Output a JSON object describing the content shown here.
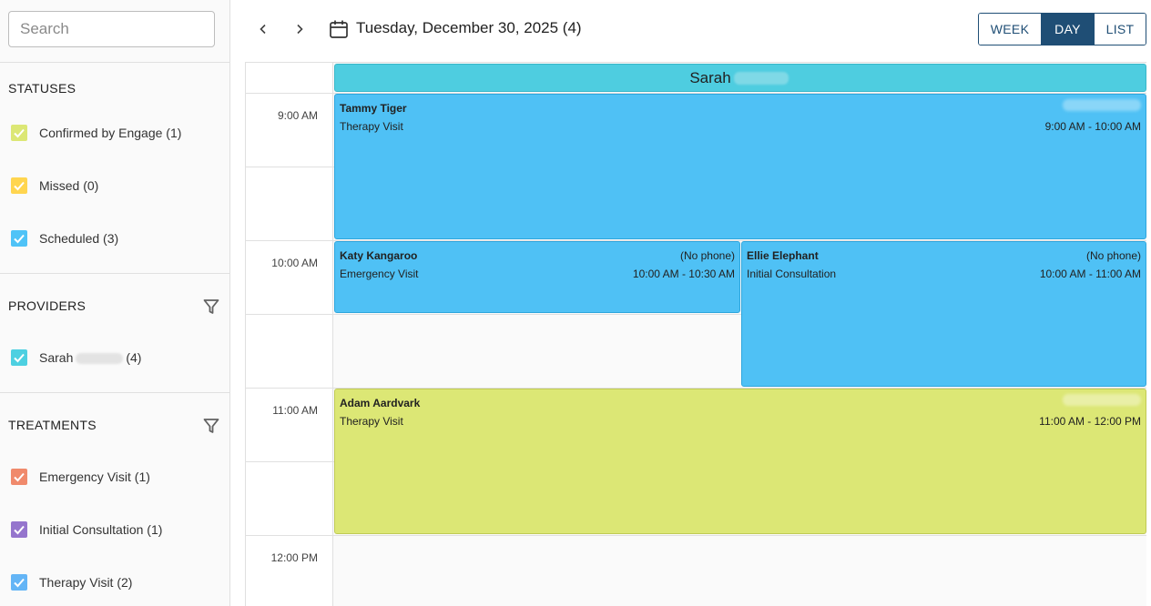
{
  "search": {
    "placeholder": "Search"
  },
  "statuses": {
    "title": "STATUSES",
    "items": [
      {
        "label": "Confirmed by Engage (1)",
        "color": "#dce775"
      },
      {
        "label": "Missed (0)",
        "color": "#ffd54f"
      },
      {
        "label": "Scheduled (3)",
        "color": "#4fc3f7"
      }
    ]
  },
  "providers": {
    "title": "PROVIDERS",
    "items": [
      {
        "first_name": "Sarah",
        "count": "(4)",
        "color": "#4dd0e1"
      }
    ]
  },
  "treatments": {
    "title": "TREATMENTS",
    "items": [
      {
        "label": "Emergency Visit (1)",
        "color": "#f08a6c"
      },
      {
        "label": "Initial Consultation (1)",
        "color": "#9575cd"
      },
      {
        "label": "Therapy Visit (2)",
        "color": "#64b5f6"
      }
    ]
  },
  "header": {
    "date_title": "Tuesday, December 30, 2025 (4)",
    "views": [
      "WEEK",
      "DAY",
      "LIST"
    ],
    "active_view": "DAY"
  },
  "calendar": {
    "resource": "Sarah",
    "times": [
      "9:00 AM",
      "10:00 AM",
      "11:00 AM",
      "12:00 PM"
    ],
    "events": [
      {
        "name": "Tammy Tiger",
        "type": "Therapy Visit",
        "time": "9:00 AM - 10:00 AM",
        "phone": ""
      },
      {
        "name": "Katy Kangaroo",
        "type": "Emergency Visit",
        "time": "10:00 AM - 10:30 AM",
        "phone": "(No phone)"
      },
      {
        "name": "Ellie Elephant",
        "type": "Initial Consultation",
        "time": "10:00 AM - 11:00 AM",
        "phone": "(No phone)"
      },
      {
        "name": "Adam Aardvark",
        "type": "Therapy Visit",
        "time": "11:00 AM - 12:00 PM",
        "phone": ""
      }
    ]
  },
  "colors": {
    "accent": "#1f4e75",
    "event_blue": "#4fc1f5",
    "event_yellow": "#dce775",
    "resource_header": "#4ecde0"
  }
}
